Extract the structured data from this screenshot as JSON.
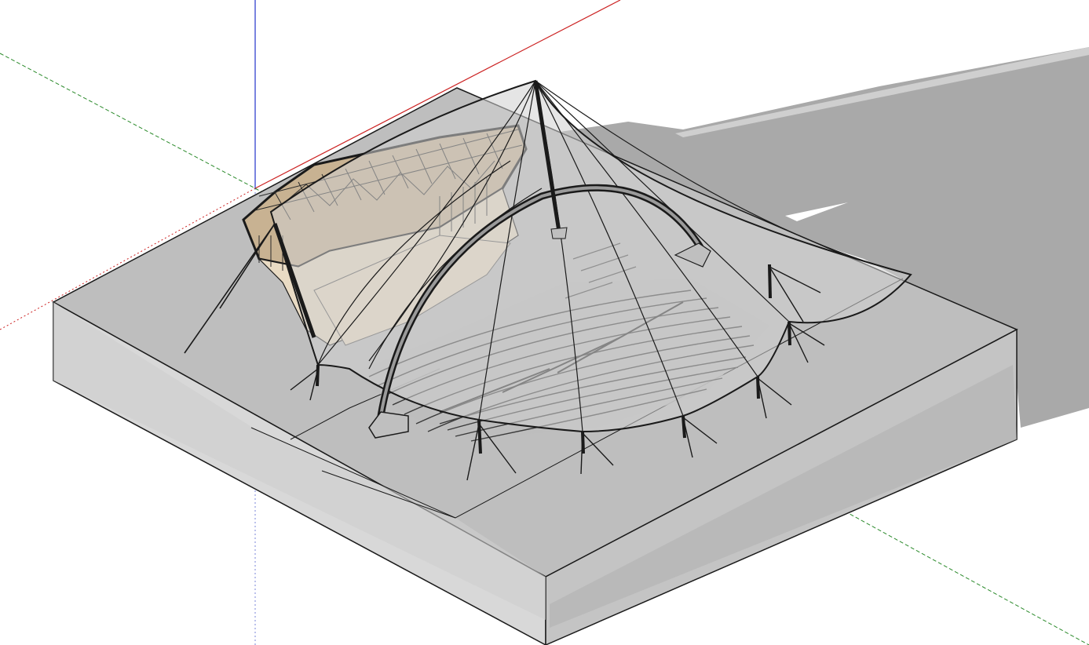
{
  "app": {
    "view": "3d-model-viewport"
  },
  "colors": {
    "background": "#ffffff",
    "axis_red": "#cc2222",
    "axis_green": "#2a8a2a",
    "axis_blue": "#2233cc",
    "site_box_top": "#bdbdbd",
    "site_box_front": "#d9d9d9",
    "site_box_side": "#c6c6c6",
    "shadow": "#a7a7a7",
    "membrane": "#cfcfcf",
    "stage_wood": "#e8d8c0",
    "edge": "#1a1a1a"
  },
  "icons": {
    "model": "amphitheater-canopy-model",
    "axes": "axis-lines"
  }
}
